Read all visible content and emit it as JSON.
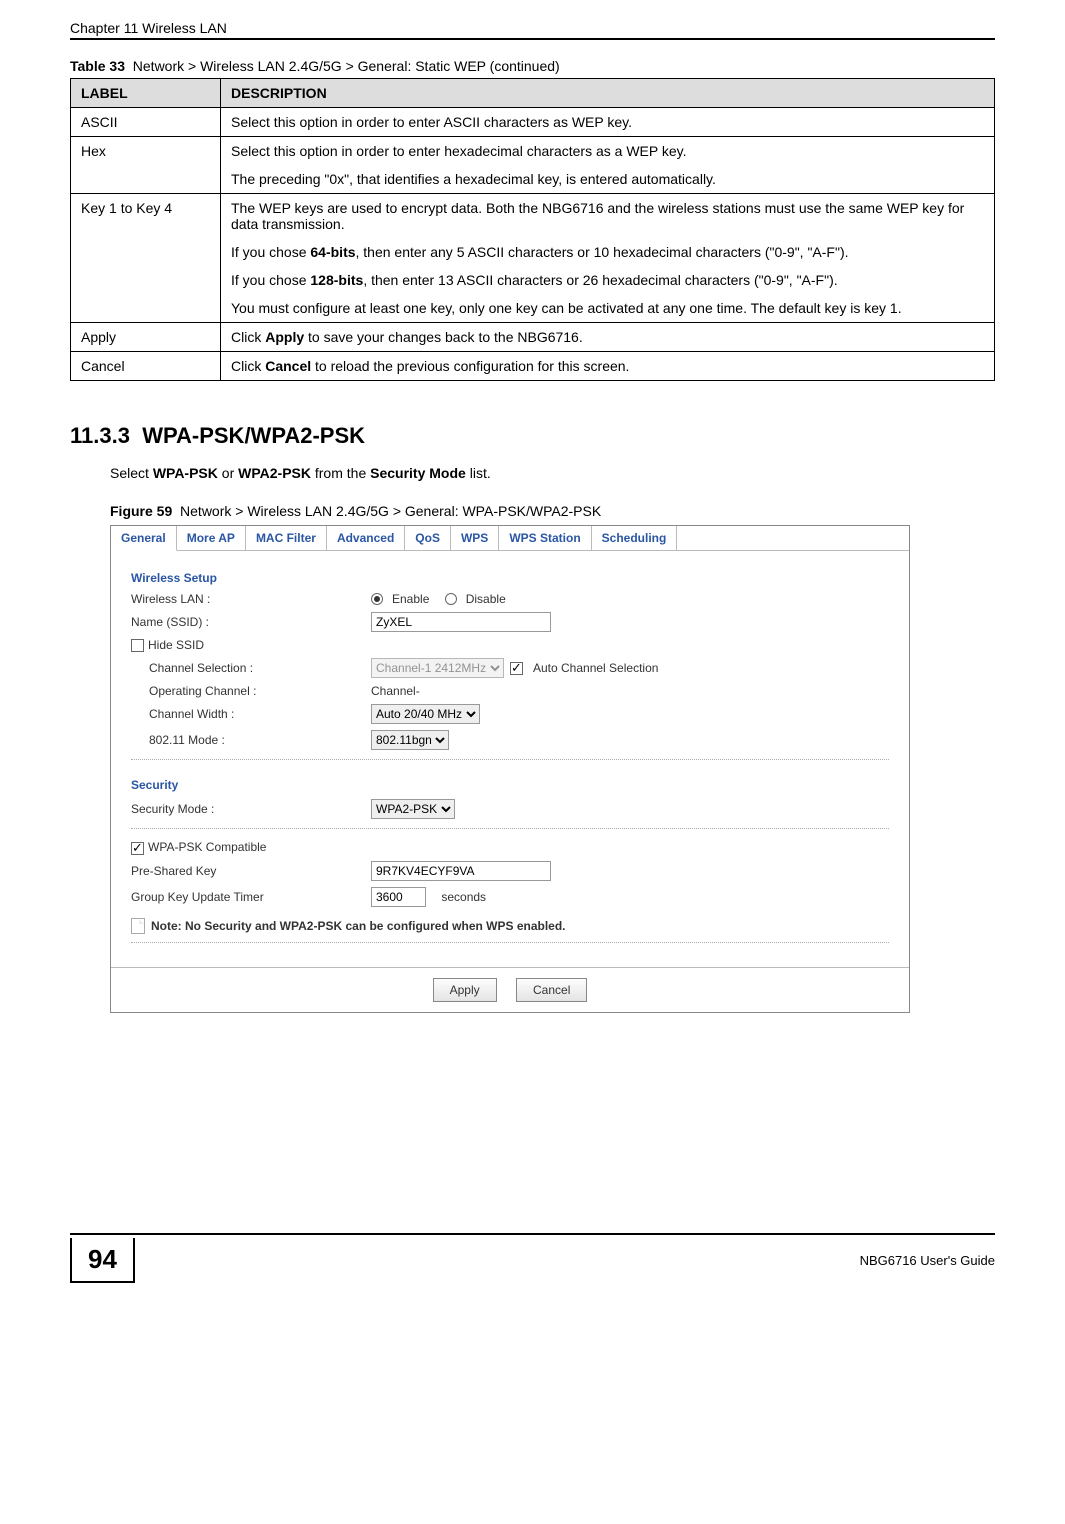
{
  "header": {
    "chapter": "Chapter 11 Wireless LAN"
  },
  "table": {
    "caption_label": "Table 33",
    "caption_text": "Network > Wireless LAN 2.4G/5G > General: Static WEP (continued)",
    "col_label": "LABEL",
    "col_desc": "DESCRIPTION",
    "rows": {
      "ascii": {
        "label": "ASCII",
        "p1": "Select this option in order to enter ASCII characters as WEP key."
      },
      "hex": {
        "label": "Hex",
        "p1": "Select this option in order to enter hexadecimal characters as a WEP key.",
        "p2": "The preceding \"0x\", that identifies a hexadecimal key, is entered automatically."
      },
      "keys": {
        "label": "Key 1 to Key 4",
        "p1": "The WEP keys are used to encrypt data. Both the NBG6716 and the wireless stations must use the same WEP key for data transmission.",
        "p2a": "If you chose ",
        "p2b": "64-bits",
        "p2c": ", then enter any 5 ASCII characters or 10 hexadecimal characters (\"0-9\", \"A-F\").",
        "p3a": "If you chose ",
        "p3b": "128-bits",
        "p3c": ", then enter 13 ASCII characters or 26 hexadecimal characters (\"0-9\", \"A-F\").",
        "p4": "You must configure at least one key, only one key can be activated at any one time. The default key is key 1."
      },
      "apply": {
        "label": "Apply",
        "p1a": "Click ",
        "p1b": "Apply",
        "p1c": " to save your changes back to the NBG6716."
      },
      "cancel": {
        "label": "Cancel",
        "p1a": "Click ",
        "p1b": "Cancel",
        "p1c": " to reload the previous configuration for this screen."
      }
    }
  },
  "section": {
    "number": "11.3.3",
    "title": "WPA-PSK/WPA2-PSK",
    "intro_a": "Select ",
    "intro_b": "WPA-PSK",
    "intro_c": " or ",
    "intro_d": "WPA2-PSK",
    "intro_e": " from the ",
    "intro_f": "Security Mode",
    "intro_g": " list."
  },
  "figure": {
    "label": "Figure 59",
    "text": "Network > Wireless LAN 2.4G/5G > General: WPA-PSK/WPA2-PSK"
  },
  "screenshot": {
    "tabs": {
      "general": "General",
      "moreap": "More AP",
      "mac": "MAC Filter",
      "adv": "Advanced",
      "qos": "QoS",
      "wps": "WPS",
      "wpsstation": "WPS Station",
      "sched": "Scheduling"
    },
    "wireless_setup_hdr": "Wireless Setup",
    "wlan_label": "Wireless LAN :",
    "enable": "Enable",
    "disable": "Disable",
    "ssid_label": "Name (SSID) :",
    "ssid_value": "ZyXEL",
    "hide_ssid": "Hide SSID",
    "chan_sel_label": "Channel Selection :",
    "chan_sel_value": "Channel-1 2412MHz",
    "auto_chan": "Auto Channel Selection",
    "oper_chan_label": "Operating Channel :",
    "oper_chan_value": "Channel-",
    "chan_width_label": "Channel Width :",
    "chan_width_value": "Auto 20/40 MHz",
    "mode_label": "802.11 Mode :",
    "mode_value": "802.11bgn",
    "security_hdr": "Security",
    "sec_mode_label": "Security Mode :",
    "sec_mode_value": "WPA2-PSK",
    "wpa_compat": "WPA-PSK Compatible",
    "psk_label": "Pre-Shared Key",
    "psk_value": "9R7KV4ECYF9VA",
    "gkut_label": "Group Key Update Timer",
    "gkut_value": "3600",
    "seconds": "seconds",
    "note": "Note: No Security and WPA2-PSK can be configured when WPS enabled.",
    "apply_btn": "Apply",
    "cancel_btn": "Cancel"
  },
  "footer": {
    "page": "94",
    "guide": "NBG6716 User's Guide"
  }
}
